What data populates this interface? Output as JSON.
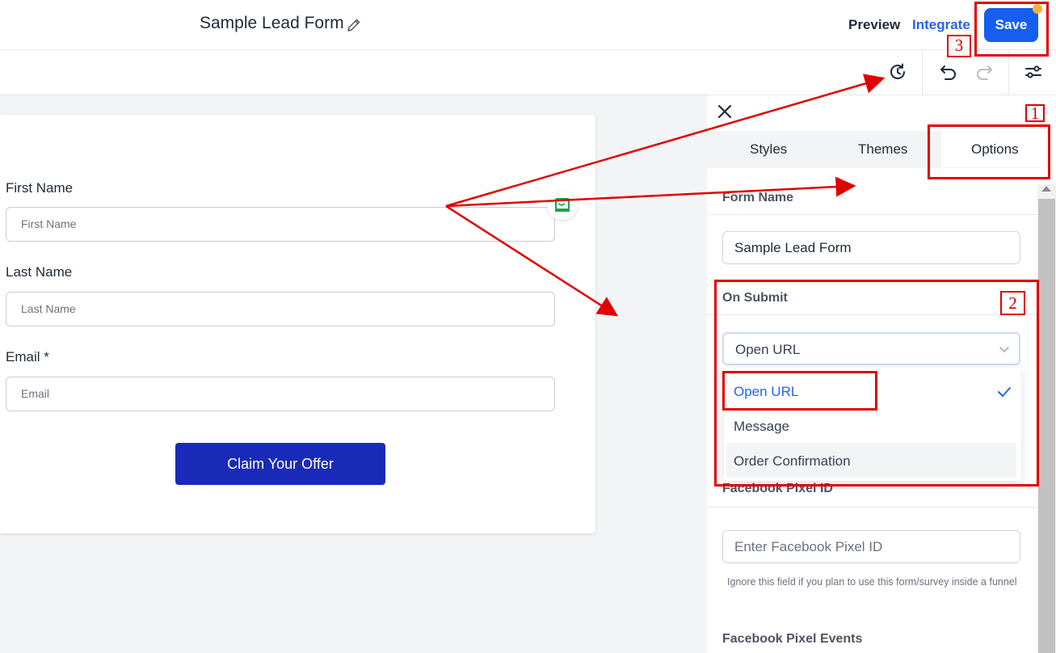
{
  "header": {
    "form_title": "Sample Lead Form",
    "preview_label": "Preview",
    "integrate_label": "Integrate",
    "save_label": "Save"
  },
  "form": {
    "fields": [
      {
        "label": "First Name",
        "placeholder": "First Name"
      },
      {
        "label": "Last Name",
        "placeholder": "Last Name"
      },
      {
        "label": "Email *",
        "placeholder": "Email"
      }
    ],
    "submit_label": "Claim Your Offer"
  },
  "panel": {
    "tabs": [
      "Styles",
      "Themes",
      "Options"
    ],
    "active_tab": "Options",
    "form_name_label": "Form Name",
    "form_name_value": "Sample Lead Form",
    "on_submit_label": "On Submit",
    "on_submit_value": "Open URL",
    "on_submit_options": [
      "Open URL",
      "Message",
      "Order Confirmation"
    ],
    "fb_pixel_label": "Facebook Pixel ID",
    "fb_pixel_placeholder": "Enter Facebook Pixel ID",
    "fb_pixel_help": "Ignore this field if you plan to use this form/survey inside a funnel",
    "fb_events_label": "Facebook Pixel Events"
  },
  "annotations": {
    "step1": "1",
    "step2": "2",
    "step3": "3"
  },
  "colors": {
    "accent_blue": "#155eef",
    "cta_blue": "#1a2ab8",
    "annotation_red": "#e00000",
    "notification_dot": "#f5b335"
  }
}
